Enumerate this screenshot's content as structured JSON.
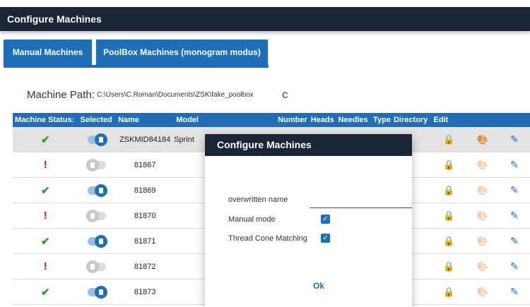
{
  "app": {
    "title": "Configure Machines"
  },
  "tabs": [
    {
      "label": "Manual Machines"
    },
    {
      "label": "PoolBox Machines (monogram modus)"
    }
  ],
  "path": {
    "label": "Machine Path:",
    "value": "C:\\Users\\C.Roman\\Documents\\ZSK\\fake_poolbox",
    "refresh_icon": "C"
  },
  "table": {
    "headers": [
      "Machine Status:",
      "Selected",
      "Name",
      "Model",
      "Number",
      "Heads",
      "Needles",
      "Type",
      "Directory",
      "Edit"
    ],
    "rows": [
      {
        "status": "ok",
        "selected": true,
        "name": "ZSKMID84184",
        "model": "Sprint "
      },
      {
        "status": "error",
        "selected": false,
        "name": "81867",
        "model": ""
      },
      {
        "status": "ok",
        "selected": true,
        "name": "81869",
        "model": ""
      },
      {
        "status": "error",
        "selected": false,
        "name": "81870",
        "model": ""
      },
      {
        "status": "ok",
        "selected": true,
        "name": "81871",
        "model": ""
      },
      {
        "status": "error",
        "selected": false,
        "name": "81872",
        "model": ""
      },
      {
        "status": "ok",
        "selected": true,
        "name": "81873",
        "model": ""
      }
    ]
  },
  "icons": {
    "ok": "✔",
    "error": "!",
    "lock": "🔒",
    "palette": "🎨",
    "edit": "✎"
  },
  "dialog": {
    "title": "Configure Machines",
    "name_label": "overwritten name",
    "name_value": "",
    "manual_mode_label": "Manual mode",
    "manual_mode_checked": true,
    "thread_label": "Thread Cone Matching",
    "thread_checked": true,
    "ok_label": "Ok"
  },
  "colors": {
    "primary": "#1f6fb8",
    "header_dark": "#1a2535",
    "ok": "#2aa02a",
    "error": "#e01010"
  }
}
